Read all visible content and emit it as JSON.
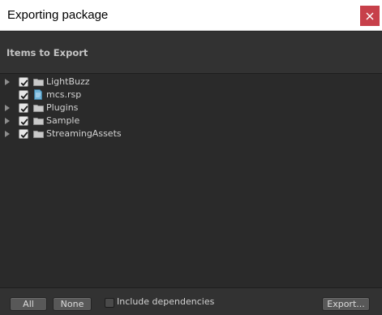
{
  "window": {
    "title": "Exporting package",
    "close_icon": "close-icon"
  },
  "header": {
    "heading": "Items to Export"
  },
  "tree": {
    "items": [
      {
        "label": "LightBuzz",
        "icon": "folder-icon",
        "checked": true,
        "has_children": true
      },
      {
        "label": "mcs.rsp",
        "icon": "file-icon",
        "checked": true,
        "has_children": false
      },
      {
        "label": "Plugins",
        "icon": "folder-icon",
        "checked": true,
        "has_children": true
      },
      {
        "label": "Sample",
        "icon": "folder-icon",
        "checked": true,
        "has_children": true
      },
      {
        "label": "StreamingAssets",
        "icon": "folder-icon",
        "checked": true,
        "has_children": true
      }
    ]
  },
  "footer": {
    "all_label": "All",
    "none_label": "None",
    "include_dependencies_label": "Include dependencies",
    "include_dependencies_checked": false,
    "export_label": "Export..."
  },
  "colors": {
    "close_button": "#c7404a",
    "background": "#2a2a2a",
    "panel": "#323232",
    "text": "#d2d2d2"
  }
}
